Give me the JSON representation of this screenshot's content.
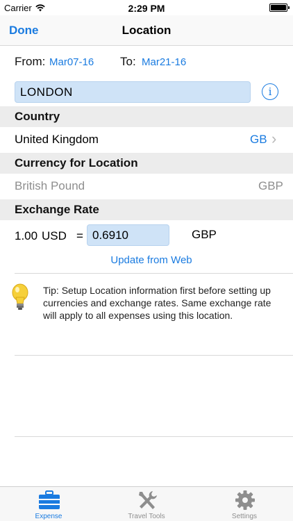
{
  "status_bar": {
    "carrier": "Carrier",
    "time": "2:29 PM",
    "battery_level": 1.0
  },
  "nav": {
    "title": "Location",
    "done_label": "Done"
  },
  "dates": {
    "from_label": "From:",
    "from_value": "Mar07-16",
    "to_label": "To:",
    "to_value": "Mar21-16"
  },
  "location": {
    "value": "LONDON",
    "info_symbol": "i"
  },
  "country": {
    "header": "Country",
    "name": "United Kingdom",
    "code": "GB",
    "chevron": "›"
  },
  "currency": {
    "header": "Currency for Location",
    "name": "British Pound",
    "code": "GBP"
  },
  "exchange": {
    "header": "Exchange Rate",
    "base_amount": "1.00",
    "base_currency": "USD",
    "equals": "=",
    "rate": "0.6910",
    "target_currency": "GBP",
    "update_label": "Update from Web"
  },
  "tip": {
    "text": "Tip: Setup Location information first before setting up currencies and exchange rates. Same exchange rate will apply to all expenses using this location."
  },
  "tabs": [
    {
      "label": "Expense",
      "icon": "suitcase-icon",
      "active": true
    },
    {
      "label": "Travel Tools",
      "icon": "tools-icon",
      "active": false
    },
    {
      "label": "Settings",
      "icon": "gear-icon",
      "active": false
    }
  ],
  "colors": {
    "accent": "#1a7be0",
    "field_bg": "#cfe3f7",
    "section_bg": "#ececec",
    "muted": "#8e8e8e"
  }
}
